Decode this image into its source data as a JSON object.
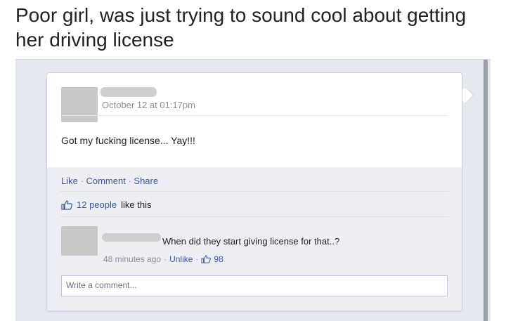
{
  "caption": "Poor girl, was just trying to sound cool about getting her driving license",
  "post": {
    "timestamp": "October 12 at 01:17pm",
    "text": "Got my fucking license... Yay!!!",
    "actions": {
      "like": "Like",
      "comment": "Comment",
      "share": "Share",
      "separator": "·"
    },
    "likes": {
      "count_text": "12 people",
      "suffix": "like this"
    }
  },
  "comment": {
    "text": "When did they start giving license for that..?",
    "time": "48 minutes ago",
    "unlike": "Unlike",
    "like_count": "98",
    "separator": "·"
  },
  "write_comment": {
    "placeholder": "Write a comment..."
  },
  "colors": {
    "link": "#3b5998",
    "muted": "#8a8f97"
  }
}
